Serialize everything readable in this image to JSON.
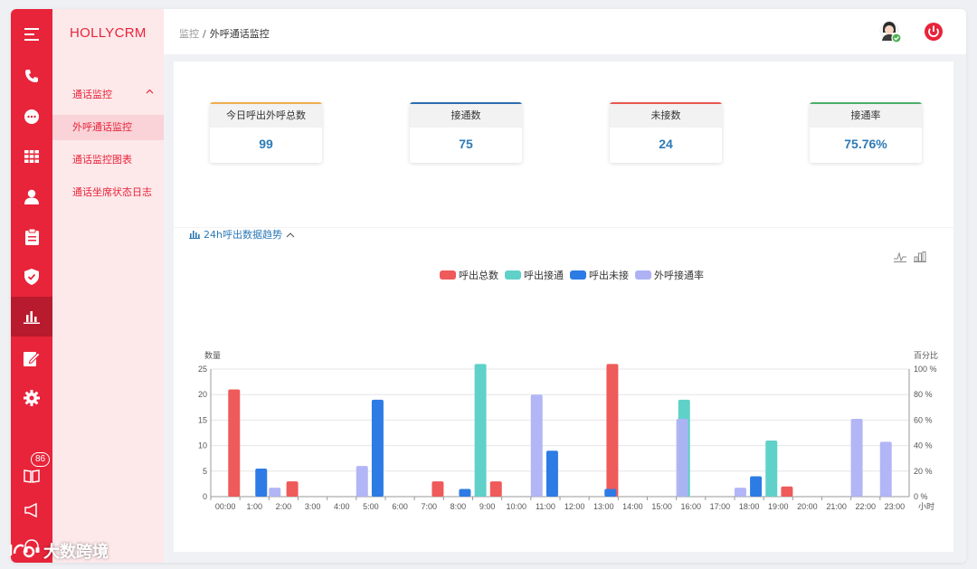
{
  "sidebar": {
    "icons": [
      "menu-icon",
      "phone-icon",
      "chat-icon",
      "grid-icon",
      "user-icon",
      "clipboard-icon",
      "shield-icon",
      "bar-chart-icon",
      "edit-doc-icon",
      "gear-icon",
      "book-icon",
      "megaphone-icon",
      "headset-icon"
    ],
    "badge": "86"
  },
  "submenu": {
    "brand": "HOLLYCRM",
    "group_label": "通话监控",
    "items": [
      "外呼通话监控",
      "通话监控图表",
      "通话坐席状态日志"
    ]
  },
  "header": {
    "breadcrumb": [
      "监控",
      "外呼通话监控"
    ],
    "separator": "/"
  },
  "stats": [
    {
      "label": "今日呼出外呼总数",
      "value": "99",
      "color": "#f0ad4e"
    },
    {
      "label": "接通数",
      "value": "75",
      "color": "#2d6db0"
    },
    {
      "label": "未接数",
      "value": "24",
      "color": "#e8574f"
    },
    {
      "label": "接通率",
      "value": "75.76%",
      "color": "#4caf6a"
    }
  ],
  "section": {
    "title": "24h呼出数据趋势"
  },
  "watermark": "大数跨境",
  "chart_data": {
    "type": "bar",
    "categories": [
      "00:00",
      "1:00",
      "2:00",
      "3:00",
      "4:00",
      "5:00",
      "6:00",
      "7:00",
      "8:00",
      "9:00",
      "10:00",
      "11:00",
      "12:00",
      "13:00",
      "14:00",
      "15:00",
      "16:00",
      "17:00",
      "18:00",
      "19:00",
      "20:00",
      "21:00",
      "22:00",
      "23:00"
    ],
    "ylabel": "数量",
    "y2label": "百分比",
    "xlabel": "小时",
    "ylim": [
      0,
      25
    ],
    "y2lim": [
      0,
      100
    ],
    "yticks": [
      "0",
      "5",
      "10",
      "15",
      "20",
      "25"
    ],
    "y2ticks": [
      "0 %",
      "20 %",
      "40 %",
      "60 %",
      "80 %",
      "100 %"
    ],
    "legend_position": "top-center",
    "series": [
      {
        "name": "呼出总数",
        "color": "#ef5a5a",
        "axis": "left",
        "values": [
          0,
          21,
          0,
          3,
          0,
          0,
          0,
          0,
          3,
          0,
          3,
          0,
          0,
          0,
          26,
          0,
          0,
          0,
          0,
          0,
          2,
          0,
          0,
          0
        ]
      },
      {
        "name": "呼出接通",
        "color": "#5fd1c9",
        "axis": "left",
        "values": [
          0,
          0,
          0,
          0,
          0,
          0,
          0,
          0,
          0,
          26,
          0,
          0,
          0,
          0,
          0,
          0,
          19,
          0,
          0,
          11,
          0,
          0,
          0,
          0
        ]
      },
      {
        "name": "呼出未接",
        "color": "#2d7be5",
        "axis": "left",
        "values": [
          0,
          5.5,
          0,
          0,
          0,
          19,
          0,
          0,
          1.5,
          0,
          0,
          9,
          0,
          1.5,
          0,
          0,
          0,
          0,
          4,
          0,
          0,
          0,
          0,
          0
        ]
      },
      {
        "name": "外呼接通率",
        "color": "#aeb2f5",
        "axis": "right",
        "values": [
          0,
          7,
          0,
          0,
          24,
          0,
          0,
          0,
          0,
          0,
          80,
          0,
          0,
          0,
          0,
          61,
          0,
          7,
          0,
          0,
          0,
          61,
          43,
          0
        ]
      }
    ]
  }
}
